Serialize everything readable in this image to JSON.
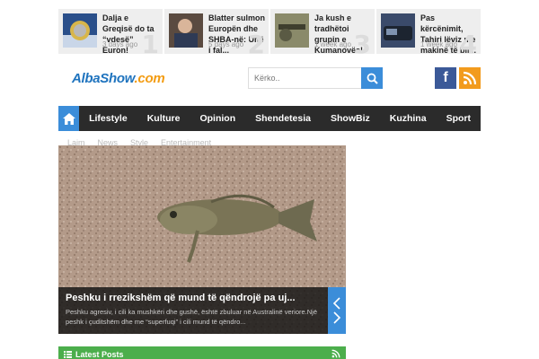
{
  "trending": [
    {
      "title": "Dalja e Greqisë do ta “vdesë” Euron!",
      "date": "3 days ago",
      "num": "1"
    },
    {
      "title": "Blatter sulmon Europën dhe SHBA-në: Unë i fal...",
      "date": "5 days ago",
      "num": "2"
    },
    {
      "title": "Ja kush e tradhëtoi grupin e Kumanovës! (Vide...",
      "date": "1 week ago",
      "num": "3"
    },
    {
      "title": "Pas kërcënimit, Tahiri lëviz me makinë të bli...",
      "date": "1 week ago",
      "num": "4"
    }
  ],
  "logo": {
    "part1": "AlbaShow",
    "part2": ".com"
  },
  "search": {
    "placeholder": "Kërko.."
  },
  "social": {
    "facebook": "f"
  },
  "nav": {
    "items": [
      "Lifestyle",
      "Kulture",
      "Opinion",
      "Shendetesia",
      "ShowBiz",
      "Kuzhina",
      "Sport"
    ]
  },
  "breadcrumbs": [
    "Lajm",
    "News",
    "Style",
    "Entertainment"
  ],
  "hero": {
    "title": "Peshku i rrezikshëm që mund të qëndrojë pa uj...",
    "excerpt": "Peshku agresiv, i cili ka mushkëri dhe gushë, është zbuluar në Australinë veriore.Një peshk i çuditshëm dhe me “superfuqi” i cili mund të qëndro..."
  },
  "latest": {
    "label": "Latest Posts"
  },
  "colors": {
    "accent": "#3b8dd9",
    "nav_bg": "#2b2b2b",
    "green": "#4cae4c",
    "rss": "#f29b1d",
    "facebook": "#3b5998"
  }
}
